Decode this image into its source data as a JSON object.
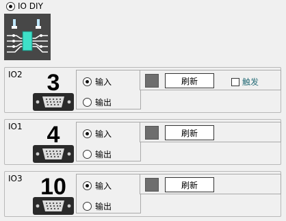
{
  "top_option": {
    "label": "IO DIY",
    "selected": true
  },
  "groups": [
    {
      "title": "IO2",
      "port_number": "3",
      "modes": [
        {
          "label": "输入",
          "selected": true
        },
        {
          "label": "输出",
          "selected": false
        }
      ],
      "refresh_label": "刷新",
      "trigger_label": "触发",
      "trigger_checked": false
    },
    {
      "title": "IO1",
      "port_number": "4",
      "modes": [
        {
          "label": "输入",
          "selected": true
        },
        {
          "label": "输出",
          "selected": false
        }
      ],
      "refresh_label": "刷新"
    },
    {
      "title": "IO3",
      "port_number": "10",
      "modes": [
        {
          "label": "输入",
          "selected": true
        },
        {
          "label": "输出",
          "selected": false
        }
      ],
      "refresh_label": "刷新"
    }
  ],
  "colors": {
    "status_indicator": "#6e6e6e",
    "trigger_label": "#2a6f7a",
    "icon_bg": "#474747",
    "chip": "#3ee0c8"
  }
}
